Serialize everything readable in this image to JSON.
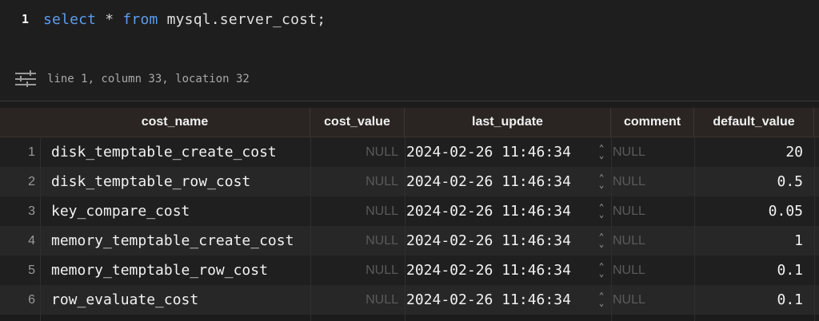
{
  "editor": {
    "line_number": "1",
    "code": {
      "kw_select": "select",
      "op_star": "*",
      "kw_from": "from",
      "table": "mysql.server_cost;"
    },
    "status_text": "line 1, column 33, location 32"
  },
  "grid": {
    "columns": [
      "cost_name",
      "cost_value",
      "last_update",
      "comment",
      "default_value"
    ],
    "rows": [
      {
        "num": "1",
        "cost_name": "disk_temptable_create_cost",
        "cost_value": "NULL",
        "last_update": "2024-02-26 11:46:34",
        "comment": "NULL",
        "default_value": "20"
      },
      {
        "num": "2",
        "cost_name": "disk_temptable_row_cost",
        "cost_value": "NULL",
        "last_update": "2024-02-26 11:46:34",
        "comment": "NULL",
        "default_value": "0.5"
      },
      {
        "num": "3",
        "cost_name": "key_compare_cost",
        "cost_value": "NULL",
        "last_update": "2024-02-26 11:46:34",
        "comment": "NULL",
        "default_value": "0.05"
      },
      {
        "num": "4",
        "cost_name": "memory_temptable_create_cost",
        "cost_value": "NULL",
        "last_update": "2024-02-26 11:46:34",
        "comment": "NULL",
        "default_value": "1"
      },
      {
        "num": "5",
        "cost_name": "memory_temptable_row_cost",
        "cost_value": "NULL",
        "last_update": "2024-02-26 11:46:34",
        "comment": "NULL",
        "default_value": "0.1"
      },
      {
        "num": "6",
        "cost_name": "row_evaluate_cost",
        "cost_value": "NULL",
        "last_update": "2024-02-26 11:46:34",
        "comment": "NULL",
        "default_value": "0.1"
      }
    ]
  },
  "icons": {
    "status": "sliders-icon",
    "stepper": "stepper-icon"
  },
  "colors": {
    "keyword": "#5d9cec",
    "null_text": "#5a5a5a",
    "header_bg": "#2a2522"
  }
}
